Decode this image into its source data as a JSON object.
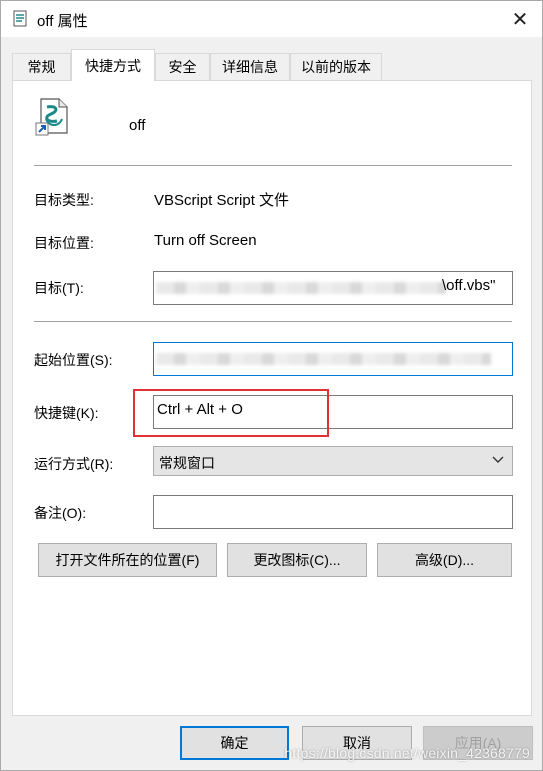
{
  "window": {
    "title": "off 属性",
    "close_symbol": "✕"
  },
  "tabs": [
    {
      "label": "常规"
    },
    {
      "label": "快捷方式"
    },
    {
      "label": "安全"
    },
    {
      "label": "详细信息"
    },
    {
      "label": "以前的版本"
    }
  ],
  "shortcut": {
    "file_name": "off",
    "target_type_label": "目标类型:",
    "target_type_value": "VBScript Script 文件",
    "target_location_label": "目标位置:",
    "target_location_value": "Turn off Screen",
    "target_label": "目标(T):",
    "target_value_visible": "\\off.vbs\"",
    "start_in_label": "起始位置(S):",
    "hotkey_label": "快捷键(K):",
    "hotkey_value": "Ctrl + Alt + O",
    "run_label": "运行方式(R):",
    "run_value": "常规窗口",
    "comment_label": "备注(O):",
    "comment_value": "",
    "open_location_button": "打开文件所在的位置(F)",
    "change_icon_button": "更改图标(C)...",
    "advanced_button": "高级(D)..."
  },
  "footer": {
    "ok_button": "确定",
    "cancel_button": "取消",
    "apply_button": "应用(A)"
  },
  "watermark": "https://blog.csdn.net/weixin_42368779",
  "colors": {
    "accent": "#0078d7",
    "highlight": "#e03232"
  }
}
